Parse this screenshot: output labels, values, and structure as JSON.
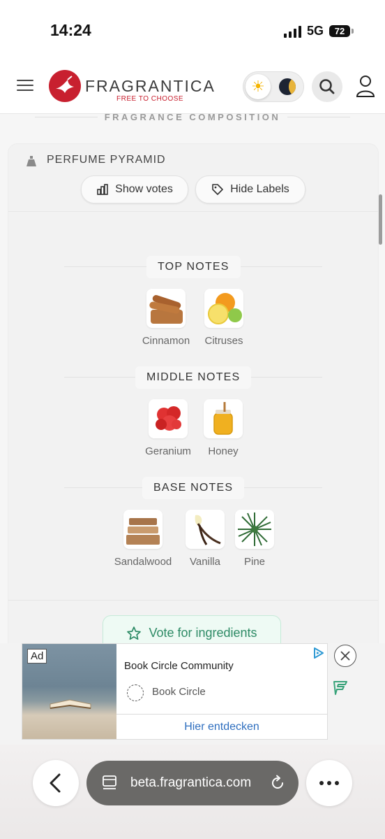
{
  "status_bar": {
    "time": "14:24",
    "network": "5G",
    "battery": "72"
  },
  "header": {
    "logo_name": "FRAGRANTICA",
    "logo_tagline": "FREE TO CHOOSE"
  },
  "section": {
    "heading": "FRAGRANCE COMPOSITION"
  },
  "pyramid": {
    "title": "PERFUME PYRAMID",
    "show_votes_label": "Show votes",
    "hide_labels_label": "Hide Labels",
    "top": {
      "label": "TOP NOTES",
      "notes": [
        "Cinnamon",
        "Citruses"
      ]
    },
    "middle": {
      "label": "MIDDLE NOTES",
      "notes": [
        "Geranium",
        "Honey"
      ]
    },
    "base": {
      "label": "BASE NOTES",
      "notes": [
        "Sandalwood",
        "Vanilla",
        "Pine"
      ]
    },
    "vote_label": "Vote for ingredients"
  },
  "ad": {
    "badge": "Ad",
    "title": "Book Circle Community",
    "brand": "Book Circle",
    "cta": "Hier entdecken"
  },
  "browser": {
    "url": "beta.fragrantica.com"
  },
  "colors": {
    "brand_red": "#c8202f",
    "vote_green": "#2e8b66",
    "link_blue": "#2f6fbf"
  }
}
